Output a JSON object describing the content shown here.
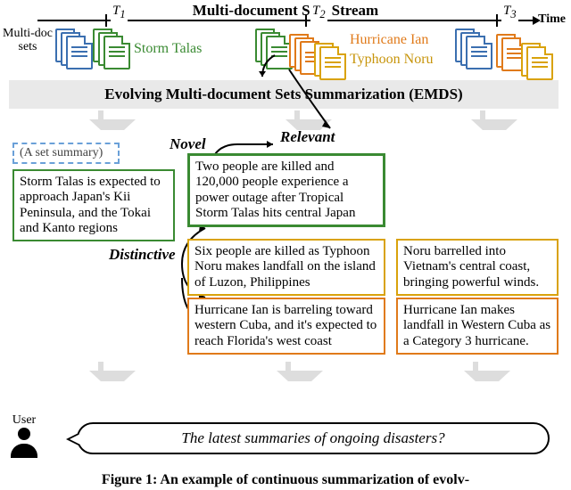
{
  "stream_title": "Multi-document Sets Stream",
  "time_axis": {
    "t1": "T",
    "t1_sub": "1",
    "t2": "T",
    "t2_sub": "2",
    "t3": "T",
    "t3_sub": "3",
    "axis_label": "Time"
  },
  "multidoc_label_line1": "Multi-doc",
  "multidoc_label_line2": "sets",
  "topics": {
    "storm_talas": "Storm Talas",
    "hurricane_ian": "Hurricane Ian",
    "typhoon_noru": "Typhoon Noru"
  },
  "emds_bar": "Evolving Multi-document Sets Summarization (EMDS)",
  "relations": {
    "novel": "Novel",
    "relevant": "Relevant",
    "distinctive": "Distinctive"
  },
  "set_summary_placeholder": "(A set summary)",
  "summaries": {
    "t1_talas": "Storm Talas is expected to approach Japan's Kii Peninsula, and the Tokai and Kanto regions",
    "t2_talas": "Two people are killed and 120,000 people experience a power outage after Tropical Storm Talas hits central Japan",
    "t2_noru": "Six people are killed as Typhoon Noru makes landfall on the island of Luzon, Philippines",
    "t3_noru": "Noru barrelled into Vietnam's central coast, bringing powerful winds.",
    "t2_ian": "Hurricane Ian is barreling toward western Cuba, and it's expected to reach Florida's west coast",
    "t3_ian": "Hurricane Ian makes landfall in Western Cuba as a Category 3 hurricane."
  },
  "user_label": "User",
  "user_query": "The latest summaries of ongoing disasters?",
  "caption": "Figure 1: An example of continuous summarization of evolv-"
}
